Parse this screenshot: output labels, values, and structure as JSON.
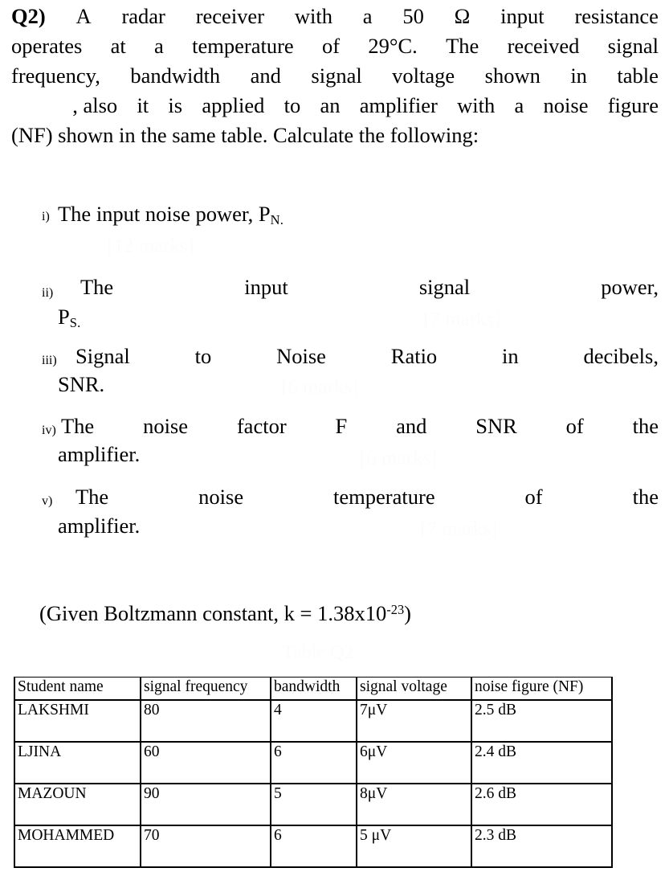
{
  "question": {
    "label": "Q2)",
    "lines": [
      "A radar receiver with a 50 Ω input resistance",
      "operates at a temperature of 29°C. The received signal",
      "frequency, bandwidth and signal voltage shown in table",
      ", also it is applied to an amplifier with a noise figure",
      "(NF) shown in the same table. Calculate the following:"
    ],
    "line1_words": [
      "A",
      "radar",
      "receiver",
      "with",
      "a",
      "50",
      "Ω",
      "input",
      "resistance"
    ],
    "line2_words": [
      "operates",
      "at",
      "a",
      "temperature",
      "of",
      "29°C.",
      "The",
      "received",
      "signal"
    ],
    "line3_words": [
      "frequency,",
      "bandwidth",
      "and",
      "signal",
      "voltage",
      "shown",
      "in",
      "table"
    ],
    "line4_words": [
      ", also",
      "it",
      "is",
      "applied",
      "to",
      "an",
      "amplifier",
      "with",
      "a",
      "noise",
      "figure"
    ],
    "line5_text": "(NF) shown in the same table. Calculate the following:"
  },
  "items": [
    {
      "marker": "i)",
      "text": "The input noise power, P",
      "subscript": "N.",
      "marks": "[12 marks]"
    },
    {
      "marker": "ii)",
      "words": [
        "The",
        "input",
        "signal",
        "power,"
      ],
      "cont_text": "P",
      "cont_subscript": "S.",
      "marks": "[7 marks]"
    },
    {
      "marker": "iii)",
      "words": [
        "Signal",
        "to",
        "Noise",
        "Ratio",
        "in",
        "decibels,"
      ],
      "cont_text": "SNR.",
      "marks": "[6 marks]"
    },
    {
      "marker": "iv)",
      "words": [
        "The",
        "noise",
        "factor",
        "F",
        "and",
        "SNR",
        "of",
        "the"
      ],
      "cont_text": "amplifier.",
      "marks": "[6 marks]"
    },
    {
      "marker": "v)",
      "words": [
        "The",
        "noise",
        "temperature",
        "of",
        "the"
      ],
      "cont_text": "amplifier.",
      "marks": "[7 marks]"
    }
  ],
  "given": {
    "prefix": "(Given Boltzmann constant, k = 1.38x10",
    "exponent": "-23",
    "suffix": ")"
  },
  "table_caption": "Table Q2",
  "table": {
    "headers": [
      "Student name",
      "signal frequency",
      "bandwidth",
      "signal voltage",
      "noise figure (NF)"
    ],
    "rows": [
      [
        "LAKSHMI",
        "80",
        "4",
        "7μV",
        "2.5 dB"
      ],
      [
        "LJINA",
        "60",
        "6",
        "6μV",
        "2.4 dB"
      ],
      [
        "MAZOUN",
        "90",
        "5",
        "8μV",
        "2.6 dB"
      ],
      [
        "MOHAMMED",
        "70",
        "6",
        "5 μV",
        "2.3 dB"
      ]
    ]
  },
  "colors": {
    "text": "#000000",
    "background": "#ffffff",
    "watermark": "#fcfcfc",
    "rule": "#000000"
  }
}
